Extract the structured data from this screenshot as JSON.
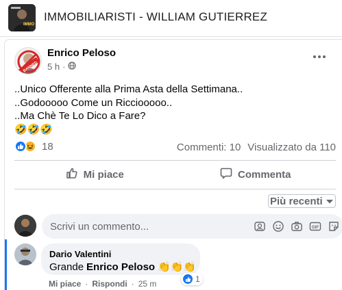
{
  "group": {
    "title": "IMMOBILIARISTI - WILLIAM GUTIERREZ",
    "avatar_text": "IMMO"
  },
  "post": {
    "author": "Enrico Peloso",
    "avatar_badge": "BANNED",
    "time": "5 h",
    "separator": "·",
    "audience_icon": "globe-icon",
    "lines": [
      "..Unico Offerente alla Prima Asta della Settimana..",
      "..Godooooo Come un Ricciooooo..",
      "..Ma Chè Te Lo Dico a Fare?",
      "🤣🤣🤣"
    ],
    "reaction_icons": [
      "like-icon",
      "haha-icon"
    ],
    "reaction_count": "18",
    "comments_count": "Commenti: 10",
    "views_count": "Visualizzato da 110"
  },
  "actions": {
    "like": "Mi piace",
    "comment": "Commenta"
  },
  "sort": {
    "label": "Più recenti"
  },
  "comment_box": {
    "placeholder": "Scrivi un commento..."
  },
  "reply": {
    "author": "Dario Valentini",
    "text_prefix": "Grande",
    "mention": "Enrico Peloso",
    "emoji": "👏👏👏",
    "like": "Mi piace",
    "reply": "Rispondi",
    "time": "25 m",
    "reaction_count": "1"
  },
  "colors": {
    "accent": "#1877f2",
    "secondary_text": "#65676b",
    "bubble": "#f0f2f5",
    "haha": "#f7b125"
  }
}
